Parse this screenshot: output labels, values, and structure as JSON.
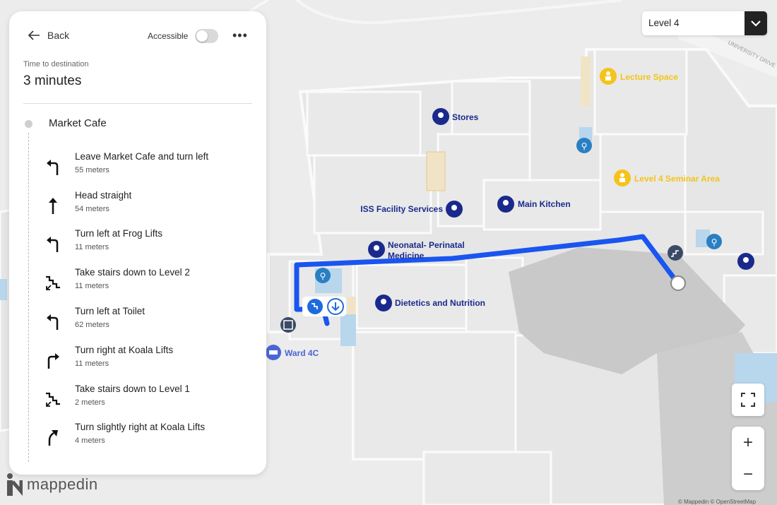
{
  "panel": {
    "back_label": "Back",
    "accessible_label": "Accessible",
    "accessible_on": false,
    "time_label": "Time to destination",
    "time_value": "3 minutes",
    "destination": "Market Cafe",
    "steps": [
      {
        "title": "Leave Market Cafe and turn left",
        "distance": "55 meters",
        "icon": "turn-left-icon"
      },
      {
        "title": "Head straight",
        "distance": "54 meters",
        "icon": "arrow-up-icon"
      },
      {
        "title": "Turn left at Frog Lifts",
        "distance": "11 meters",
        "icon": "turn-left-icon"
      },
      {
        "title": "Take stairs down to Level 2",
        "distance": "11 meters",
        "icon": "stairs-down-icon"
      },
      {
        "title": "Turn left at Toilet",
        "distance": "62 meters",
        "icon": "turn-left-icon"
      },
      {
        "title": "Turn right at Koala Lifts",
        "distance": "11 meters",
        "icon": "turn-right-icon"
      },
      {
        "title": "Take stairs down to Level 1",
        "distance": "2 meters",
        "icon": "stairs-down-icon"
      },
      {
        "title": "Turn slightly right at Koala Lifts",
        "distance": "4 meters",
        "icon": "slight-right-icon"
      }
    ]
  },
  "level_selector": {
    "value": "Level 4"
  },
  "map": {
    "street": "UNIVERSITY DRIVE",
    "pois": {
      "stores": "Stores",
      "iss": "ISS Facility Services",
      "kitchen": "Main Kitchen",
      "neonatal_1": "Neonatal- Perinatal",
      "neonatal_2": "Medicine",
      "dietetics": "Dietetics and Nutrition",
      "ward": "Ward 4C",
      "lecture": "Lecture Space",
      "seminar": "Level 4 Seminar Area"
    },
    "colors": {
      "route": "#1a55f0",
      "poi": "#1a2a8c",
      "amenity": "#2a7fc2",
      "venue": "#f4c41a"
    }
  },
  "controls": {
    "zoom_in": "+",
    "zoom_out": "−"
  },
  "branding": {
    "logo_text": "mappedin",
    "attribution": "© Mappedin © OpenStreetMap"
  }
}
